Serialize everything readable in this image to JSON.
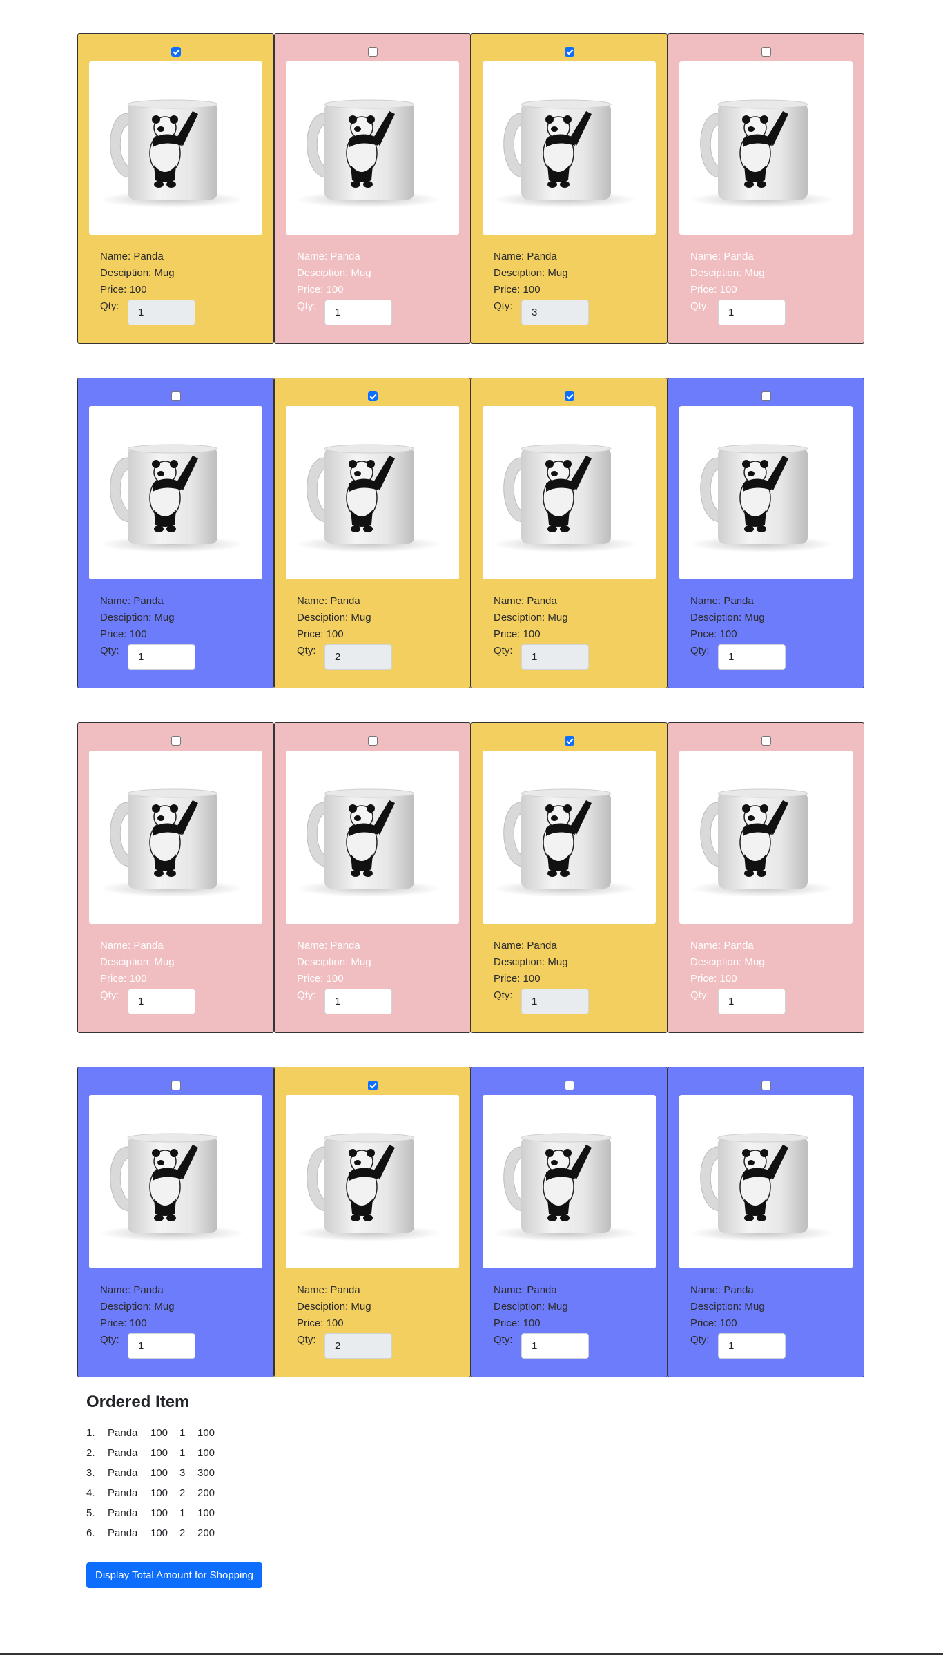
{
  "products": [
    {
      "color": "yellow",
      "checked": true,
      "qty_disabled": true,
      "name_label": "Name: Panda",
      "desc_label": "Desciption: Mug",
      "price_label": "Price: 100",
      "qty_label": "Qty:",
      "qty": "1"
    },
    {
      "color": "pink",
      "checked": false,
      "qty_disabled": false,
      "name_label": "Name: Panda",
      "desc_label": "Desciption: Mug",
      "price_label": "Price: 100",
      "qty_label": "Qty:",
      "qty": "1"
    },
    {
      "color": "yellow",
      "checked": true,
      "qty_disabled": true,
      "name_label": "Name: Panda",
      "desc_label": "Desciption: Mug",
      "price_label": "Price: 100",
      "qty_label": "Qty:",
      "qty": "3"
    },
    {
      "color": "pink",
      "checked": false,
      "qty_disabled": false,
      "name_label": "Name: Panda",
      "desc_label": "Desciption: Mug",
      "price_label": "Price: 100",
      "qty_label": "Qty:",
      "qty": "1"
    },
    {
      "color": "blue",
      "checked": false,
      "qty_disabled": false,
      "name_label": "Name: Panda",
      "desc_label": "Desciption: Mug",
      "price_label": "Price: 100",
      "qty_label": "Qty:",
      "qty": "1"
    },
    {
      "color": "yellow",
      "checked": true,
      "qty_disabled": true,
      "name_label": "Name: Panda",
      "desc_label": "Desciption: Mug",
      "price_label": "Price: 100",
      "qty_label": "Qty:",
      "qty": "2"
    },
    {
      "color": "yellow",
      "checked": true,
      "qty_disabled": true,
      "name_label": "Name: Panda",
      "desc_label": "Desciption: Mug",
      "price_label": "Price: 100",
      "qty_label": "Qty:",
      "qty": "1"
    },
    {
      "color": "blue",
      "checked": false,
      "qty_disabled": false,
      "name_label": "Name: Panda",
      "desc_label": "Desciption: Mug",
      "price_label": "Price: 100",
      "qty_label": "Qty:",
      "qty": "1"
    },
    {
      "color": "pink",
      "checked": false,
      "qty_disabled": false,
      "name_label": "Name: Panda",
      "desc_label": "Desciption: Mug",
      "price_label": "Price: 100",
      "qty_label": "Qty:",
      "qty": "1"
    },
    {
      "color": "pink",
      "checked": false,
      "qty_disabled": false,
      "name_label": "Name: Panda",
      "desc_label": "Desciption: Mug",
      "price_label": "Price: 100",
      "qty_label": "Qty:",
      "qty": "1"
    },
    {
      "color": "yellow",
      "checked": true,
      "qty_disabled": true,
      "name_label": "Name: Panda",
      "desc_label": "Desciption: Mug",
      "price_label": "Price: 100",
      "qty_label": "Qty:",
      "qty": "1"
    },
    {
      "color": "pink",
      "checked": false,
      "qty_disabled": false,
      "name_label": "Name: Panda",
      "desc_label": "Desciption: Mug",
      "price_label": "Price: 100",
      "qty_label": "Qty:",
      "qty": "1"
    },
    {
      "color": "blue",
      "checked": false,
      "qty_disabled": false,
      "name_label": "Name: Panda",
      "desc_label": "Desciption: Mug",
      "price_label": "Price: 100",
      "qty_label": "Qty:",
      "qty": "1"
    },
    {
      "color": "yellow",
      "checked": true,
      "qty_disabled": true,
      "name_label": "Name: Panda",
      "desc_label": "Desciption: Mug",
      "price_label": "Price: 100",
      "qty_label": "Qty:",
      "qty": "2"
    },
    {
      "color": "blue",
      "checked": false,
      "qty_disabled": false,
      "name_label": "Name: Panda",
      "desc_label": "Desciption: Mug",
      "price_label": "Price: 100",
      "qty_label": "Qty:",
      "qty": "1"
    },
    {
      "color": "blue",
      "checked": false,
      "qty_disabled": false,
      "name_label": "Name: Panda",
      "desc_label": "Desciption: Mug",
      "price_label": "Price: 100",
      "qty_label": "Qty:",
      "qty": "1"
    }
  ],
  "product_image_icon": "panda-mug-image",
  "colors": {
    "yellow": "#f2cf5f",
    "pink": "#f0bdc0",
    "blue": "#6d7cfb",
    "primary": "#0d6efd"
  },
  "ordered": {
    "title": "Ordered Item",
    "items": [
      {
        "num": "1.",
        "name": "Panda",
        "price": "100",
        "qty": "1",
        "total": "100"
      },
      {
        "num": "2.",
        "name": "Panda",
        "price": "100",
        "qty": "1",
        "total": "100"
      },
      {
        "num": "3.",
        "name": "Panda",
        "price": "100",
        "qty": "3",
        "total": "300"
      },
      {
        "num": "4.",
        "name": "Panda",
        "price": "100",
        "qty": "2",
        "total": "200"
      },
      {
        "num": "5.",
        "name": "Panda",
        "price": "100",
        "qty": "1",
        "total": "100"
      },
      {
        "num": "6.",
        "name": "Panda",
        "price": "100",
        "qty": "2",
        "total": "200"
      }
    ]
  },
  "button": {
    "total_label": "Display Total Amount for Shopping"
  }
}
